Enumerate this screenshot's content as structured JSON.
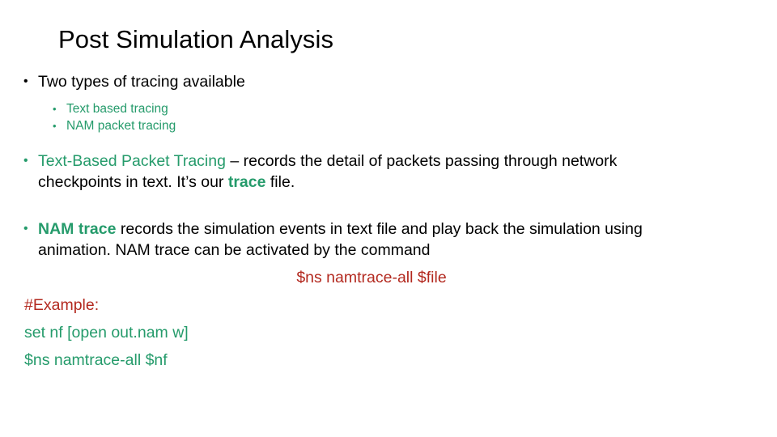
{
  "slide": {
    "title": "Post Simulation Analysis",
    "bullet_glyph": "•",
    "colors": {
      "title": "#000000",
      "body_text": "#000000",
      "accent_green": "#259B6B",
      "accent_red": "#B3291F",
      "background": "#FFFFFF"
    },
    "level1_bullet": {
      "text": "Two types of tracing available"
    },
    "level2_bullets": [
      {
        "text": "Text based tracing"
      },
      {
        "text": "NAM packet tracing"
      }
    ],
    "paragraph_text_based": {
      "term": "Text-Based Packet Tracing",
      "body_part1": " – records the detail of packets passing through network checkpoints in text. It’s our ",
      "highlight": "trace",
      "body_part2": " file."
    },
    "paragraph_nam": {
      "term": "NAM trace",
      "body": " records the simulation events in text file and play back the simulation using animation. NAM trace can be activated by the command"
    },
    "command_line": "$ns namtrace-all $file",
    "example_label": "#Example:",
    "example_lines": [
      "set nf [open out.nam w]",
      "$ns namtrace-all $nf"
    ]
  }
}
